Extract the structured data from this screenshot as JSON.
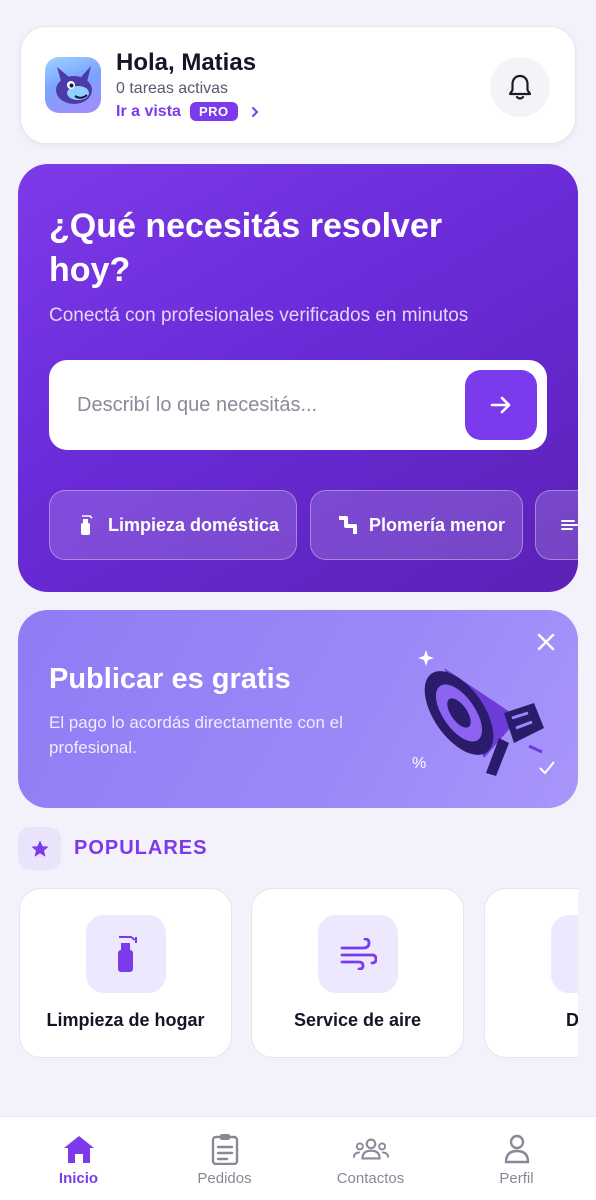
{
  "header": {
    "greeting": "Hola, Matias",
    "subtitle": "0 tareas activas",
    "vista_link": "Ir a vista",
    "pro_badge": "PRO",
    "avatar_icon": "mascot-avatar",
    "bell_icon": "bell-icon"
  },
  "hero": {
    "title": "¿Qué necesitás resolver hoy?",
    "subtitle": "Conectá con profesionales verificados en minutos",
    "search_placeholder": "Describí lo que necesitás...",
    "search_icon": "arrow-right-icon",
    "chips": [
      {
        "label": "Limpieza doméstica",
        "icon": "spray-bottle-icon"
      },
      {
        "label": "Plomería menor",
        "icon": "pipe-icon"
      },
      {
        "label": "",
        "icon": "wind-icon"
      }
    ]
  },
  "promo": {
    "title": "Publicar es gratis",
    "text": "El pago lo acordás directamente con el profesional.",
    "close_icon": "close-icon",
    "illustration": "megaphone-icon"
  },
  "popular": {
    "title": "POPULARES",
    "icon": "star-icon",
    "items": [
      {
        "label": "Limpieza de hogar",
        "icon": "spray-bottle-icon"
      },
      {
        "label": "Service de aire",
        "icon": "wind-icon"
      },
      {
        "label": "Desta",
        "icon": "pipe-icon"
      }
    ]
  },
  "nav": {
    "items": [
      {
        "label": "Inicio",
        "icon": "home-icon",
        "active": true
      },
      {
        "label": "Pedidos",
        "icon": "clipboard-icon",
        "active": false
      },
      {
        "label": "Contactos",
        "icon": "contacts-icon",
        "active": false
      },
      {
        "label": "Perfil",
        "icon": "person-icon",
        "active": false
      }
    ]
  },
  "colors": {
    "accent": "#7c3aed",
    "hero_bg": "#6a2bd8",
    "promo_bg": "#9b88f8",
    "page_bg": "#f3f1fa"
  }
}
